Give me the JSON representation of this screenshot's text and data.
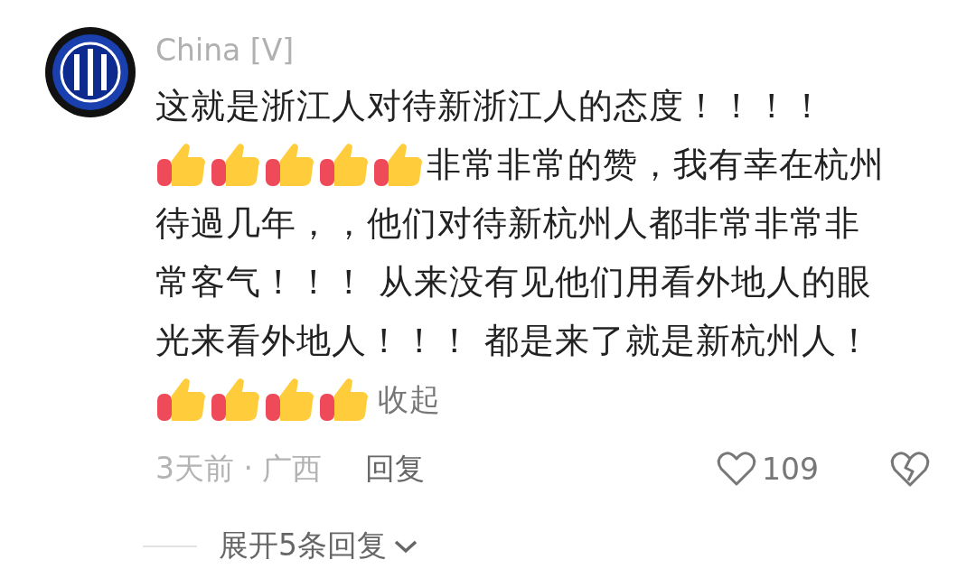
{
  "comment": {
    "author": "China [V]",
    "lines": [
      [
        {
          "kind": "text",
          "text": "这就是浙江人对待新浙江人的态度！！！！"
        }
      ],
      [
        {
          "kind": "thumb"
        },
        {
          "kind": "thumb"
        },
        {
          "kind": "thumb"
        },
        {
          "kind": "thumb"
        },
        {
          "kind": "thumb"
        },
        {
          "kind": "text",
          "text": "非常非常的赞，我有幸在杭州"
        }
      ],
      [
        {
          "kind": "text",
          "text": "待過几年，，他们对待新杭州人都非常非常非"
        }
      ],
      [
        {
          "kind": "text",
          "text": "常客气！！！ 从来没有见他们用看外地人的眼"
        }
      ],
      [
        {
          "kind": "text",
          "text": "光来看外地人！！！ 都是来了就是新杭州人！"
        }
      ],
      [
        {
          "kind": "thumb"
        },
        {
          "kind": "thumb"
        },
        {
          "kind": "thumb"
        },
        {
          "kind": "thumb"
        },
        {
          "kind": "link",
          "text": "收起"
        }
      ]
    ],
    "meta": "3天前 · 广西",
    "reply": "回复",
    "likes": "109",
    "liked": false,
    "expand": "展开5条回复"
  }
}
